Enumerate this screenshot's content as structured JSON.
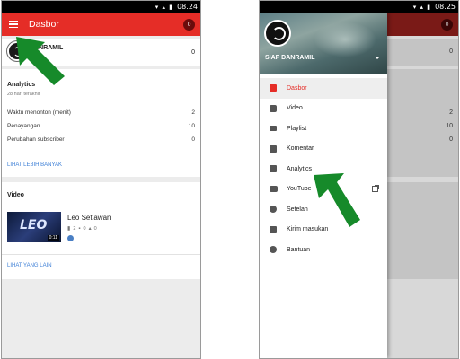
{
  "status_bar": {
    "time_left": "08.24",
    "time_right": "08.25",
    "icons": "▾ ▴ ▮"
  },
  "app_bar": {
    "title": "Dasbor",
    "notification_count": "0"
  },
  "channel": {
    "name": "SIAP DANRAMIL",
    "name_partial": "DANRAMIL",
    "subscribers": "0"
  },
  "analytics": {
    "title": "Analytics",
    "subtitle": "28 hari terakhir",
    "rows": [
      {
        "label": "Waktu menonton (menit)",
        "value": "2"
      },
      {
        "label": "Penayangan",
        "value": "10"
      },
      {
        "label": "Perubahan subscriber",
        "value": "0"
      }
    ],
    "more_link": "LIHAT LEBIH BANYAK"
  },
  "video": {
    "title": "Video",
    "item": {
      "title": "Leo Setiawan",
      "duration": "0:11",
      "likes": "2",
      "comments": "0",
      "thumbs": "0",
      "thumb_text": "LEO"
    },
    "more_link": "LIHAT YANG LAIN"
  },
  "drawer": {
    "items": [
      {
        "label": "Dasbor",
        "icon": "dashboard-icon"
      },
      {
        "label": "Video",
        "icon": "video-icon"
      },
      {
        "label": "Playlist",
        "icon": "playlist-icon"
      },
      {
        "label": "Komentar",
        "icon": "comment-icon"
      },
      {
        "label": "Analytics",
        "icon": "analytics-icon"
      },
      {
        "label": "YouTube",
        "icon": "youtube-icon"
      },
      {
        "label": "Setelan",
        "icon": "settings-icon"
      },
      {
        "label": "Kirim masukan",
        "icon": "feedback-icon"
      },
      {
        "label": "Bantuan",
        "icon": "help-icon"
      }
    ]
  },
  "background_values": {
    "subscribers": "0",
    "watch": "2",
    "views": "10",
    "sub_change": "0"
  },
  "colors": {
    "brand_red": "#e52d27",
    "link_blue": "#3d7fd6",
    "arrow_green": "#168a2a"
  }
}
